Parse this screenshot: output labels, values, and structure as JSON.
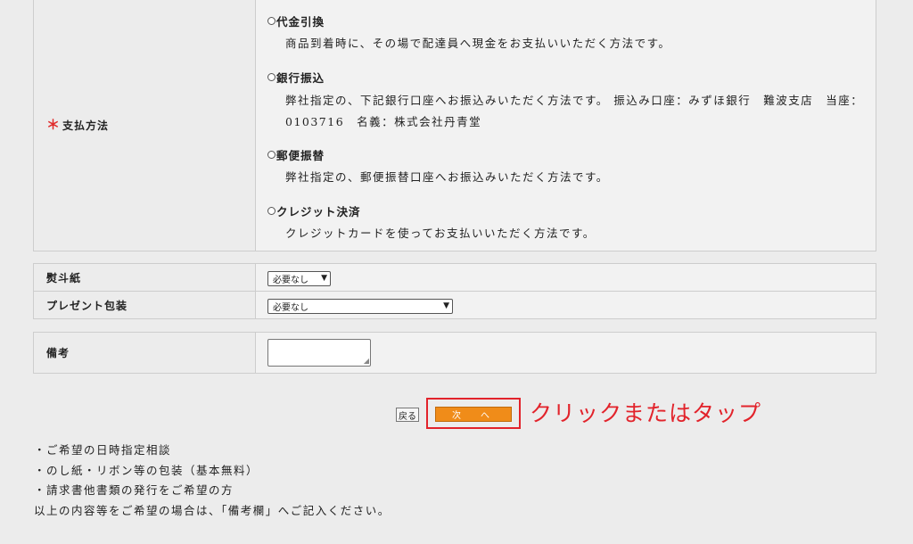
{
  "payment": {
    "label": "支払方法",
    "required_mark": "＊",
    "options": [
      {
        "name": "代金引換",
        "description": "商品到着時に、その場で配達員へ現金をお支払いいただく方法です。"
      },
      {
        "name": "銀行振込",
        "description": "弊社指定の、下記銀行口座へお振込みいただく方法です。 振込み口座：みずほ銀行　難波支店　当座：0103716　名義：株式会社丹青堂"
      },
      {
        "name": "郵便振替",
        "description": "弊社指定の、郵便振替口座へお振込みいただく方法です。"
      },
      {
        "name": "クレジット決済",
        "description": "クレジットカードを使ってお支払いいただく方法です。"
      }
    ]
  },
  "noshi": {
    "label": "熨斗紙",
    "selected": "必要なし"
  },
  "gift_wrap": {
    "label": "プレゼント包装",
    "selected": "必要なし"
  },
  "remarks": {
    "label": "備考",
    "value": ""
  },
  "buttons": {
    "back": "戻る",
    "next": "次　へ"
  },
  "annotation": "クリックまたはタップ",
  "notes": [
    "・ご希望の日時指定相談",
    "・のし紙・リボン等の包装（基本無料）",
    "・請求書他書類の発行をご希望の方",
    "以上の内容等をご希望の場合は、「備考欄」へご記入ください。"
  ],
  "colors": {
    "accent": "#f08c19",
    "highlight": "#e2232b",
    "required": "#e02c2c"
  }
}
